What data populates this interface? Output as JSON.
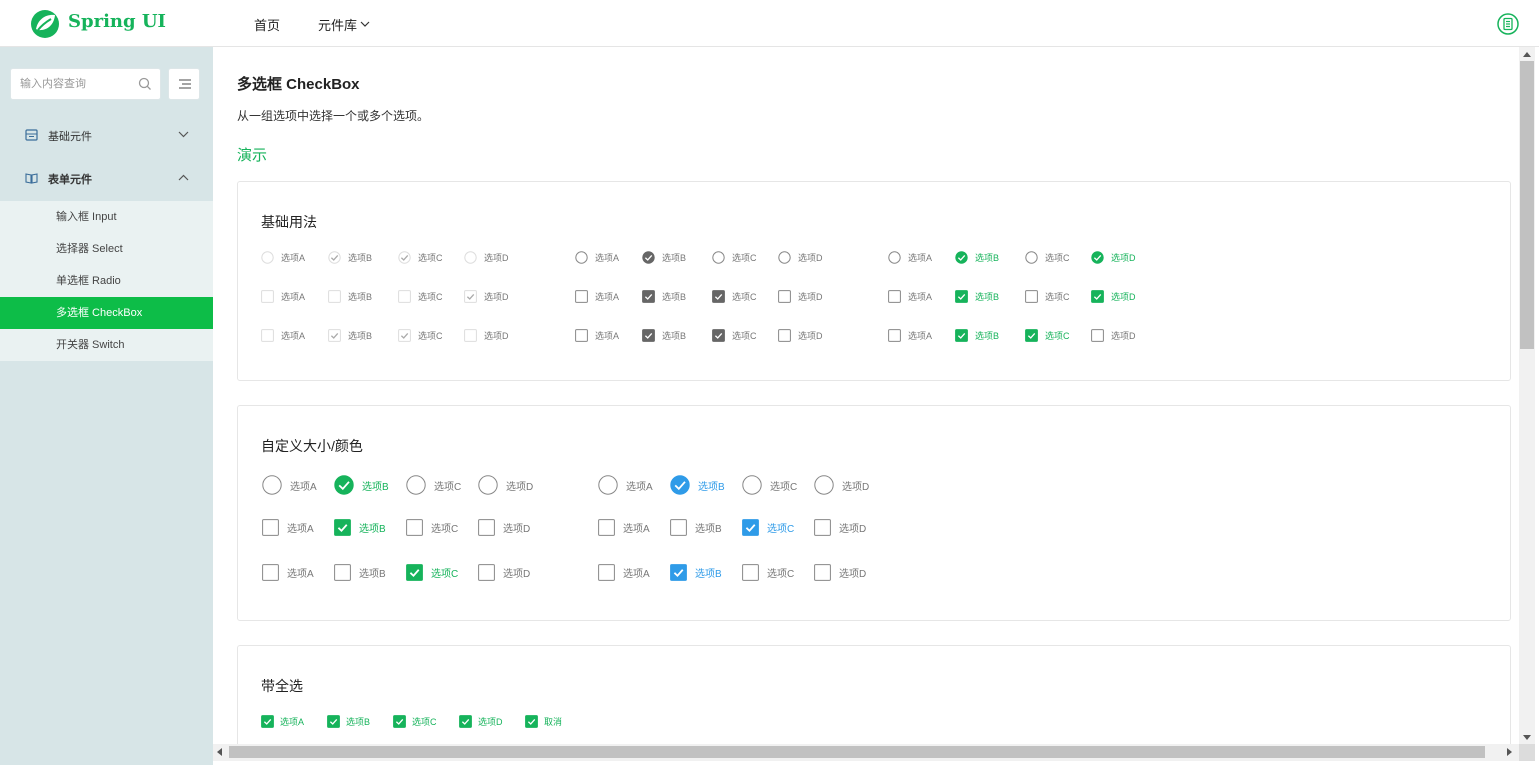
{
  "header": {
    "brand": "Spring UI",
    "nav": {
      "home": "首页",
      "library": "元件库"
    },
    "brand_color": "#16b35b"
  },
  "sidebar": {
    "search_placeholder": "输入内容查询",
    "groups": [
      {
        "label": "基础元件",
        "icon": "grid-icon",
        "expanded": false
      },
      {
        "label": "表单元件",
        "icon": "book-icon",
        "expanded": true
      }
    ],
    "items": [
      {
        "label": "输入框 Input",
        "active": false
      },
      {
        "label": "选择器 Select",
        "active": false
      },
      {
        "label": "单选框 Radio",
        "active": false
      },
      {
        "label": "多选框 CheckBox",
        "active": true
      },
      {
        "label": "开关器 Switch",
        "active": false
      }
    ],
    "active_color": "#0dbd48"
  },
  "main": {
    "title": "多选框 CheckBox",
    "description": "从一组选项中选择一个或多个选项。",
    "demo_label": "演示",
    "cards": [
      {
        "title": "基础用法"
      },
      {
        "title": "自定义大小/颜色"
      },
      {
        "title": "带全选"
      }
    ],
    "colors": {
      "green": "#16b35b",
      "blue": "#2f9be8",
      "gray": "#666666"
    },
    "options": [
      "选项A",
      "选项B",
      "选项C",
      "选项D"
    ],
    "basic_groups": [
      {
        "shape": "circle",
        "theme": "disabled",
        "checked": [
          false,
          true,
          true,
          false
        ]
      },
      {
        "shape": "circle",
        "theme": "gray",
        "checked": [
          false,
          true,
          false,
          false
        ]
      },
      {
        "shape": "circle",
        "theme": "green",
        "checked": [
          false,
          true,
          false,
          true
        ]
      },
      {
        "shape": "square",
        "theme": "disabled",
        "checked": [
          false,
          false,
          false,
          true
        ]
      },
      {
        "shape": "square",
        "theme": "gray",
        "checked": [
          false,
          true,
          true,
          false
        ]
      },
      {
        "shape": "square",
        "theme": "green",
        "checked": [
          false,
          true,
          false,
          true
        ]
      },
      {
        "shape": "square",
        "theme": "disabled",
        "checked": [
          false,
          true,
          true,
          false
        ]
      },
      {
        "shape": "square",
        "theme": "gray",
        "checked": [
          false,
          true,
          true,
          false
        ]
      },
      {
        "shape": "square",
        "theme": "green",
        "checked": [
          false,
          true,
          true,
          false
        ]
      }
    ],
    "custom_groups": [
      {
        "shape": "circle",
        "theme": "green",
        "checked": [
          false,
          true,
          false,
          false
        ]
      },
      {
        "shape": "circle",
        "theme": "blue",
        "checked": [
          false,
          true,
          false,
          false
        ]
      },
      {
        "shape": "square",
        "theme": "green",
        "checked": [
          false,
          true,
          false,
          false
        ]
      },
      {
        "shape": "square",
        "theme": "blue",
        "checked": [
          false,
          false,
          true,
          false
        ]
      },
      {
        "shape": "square",
        "theme": "green",
        "checked": [
          false,
          false,
          true,
          false
        ]
      },
      {
        "shape": "square",
        "theme": "blue",
        "checked": [
          false,
          true,
          false,
          false
        ]
      }
    ],
    "select_all": {
      "options": [
        "选项A",
        "选项B",
        "选项C",
        "选项D"
      ],
      "checked": [
        true,
        true,
        true,
        true
      ],
      "toggle_label": "取消"
    }
  }
}
